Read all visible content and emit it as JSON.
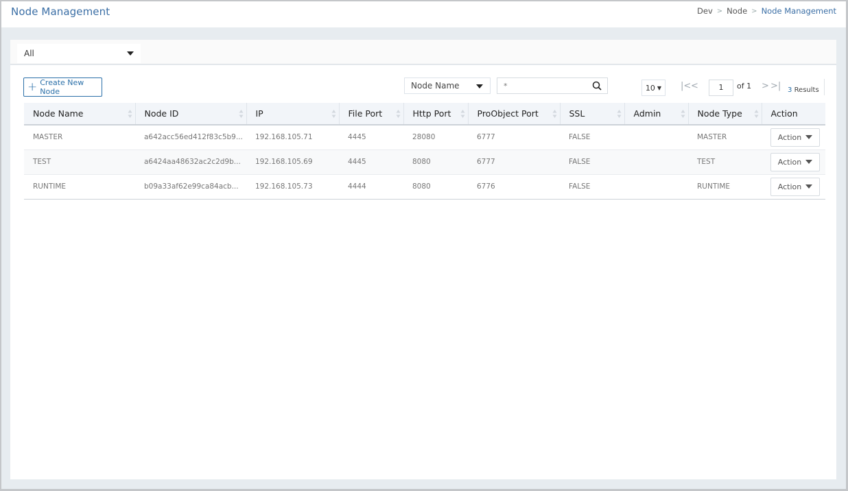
{
  "header": {
    "title": "Node Management",
    "breadcrumb": [
      "Dev",
      "Node",
      "Node Management"
    ]
  },
  "filter": {
    "selected": "All"
  },
  "toolbar": {
    "create_label": "Create New Node",
    "search_field": "Node Name",
    "search_value": "*",
    "page_size": "10",
    "current_page": "1",
    "page_of": "of 1",
    "results_count": "3",
    "results_label": "Results"
  },
  "table": {
    "columns": [
      "Node Name",
      "Node ID",
      "IP",
      "File Port",
      "Http Port",
      "ProObject Port",
      "SSL",
      "Admin",
      "Node Type",
      "Action"
    ],
    "rows": [
      {
        "name": "MASTER",
        "id": "a642acc56ed412f83c5b9...",
        "ip": "192.168.105.71",
        "file_port": "4445",
        "http_port": "28080",
        "proobject_port": "6777",
        "ssl": "FALSE",
        "admin": "",
        "type": "MASTER",
        "action": "Action"
      },
      {
        "name": "TEST",
        "id": "a6424aa48632ac2c2d9b...",
        "ip": "192.168.105.69",
        "file_port": "4445",
        "http_port": "8080",
        "proobject_port": "6777",
        "ssl": "FALSE",
        "admin": "",
        "type": "TEST",
        "action": "Action"
      },
      {
        "name": "RUNTIME",
        "id": "b09a33af62e99ca84acb...",
        "ip": "192.168.105.73",
        "file_port": "4444",
        "http_port": "8080",
        "proobject_port": "6776",
        "ssl": "FALSE",
        "admin": "",
        "type": "RUNTIME",
        "action": "Action"
      }
    ]
  },
  "icons": {
    "first": "|<",
    "prev": "<",
    "next": ">",
    "last": ">|",
    "plus": "+",
    "breadcrumb_sep": ">"
  },
  "colors": {
    "accent": "#2a6fa8",
    "title": "#3a6ea5",
    "background": "#e7ecf0",
    "header_row": "#f2f5f9"
  }
}
